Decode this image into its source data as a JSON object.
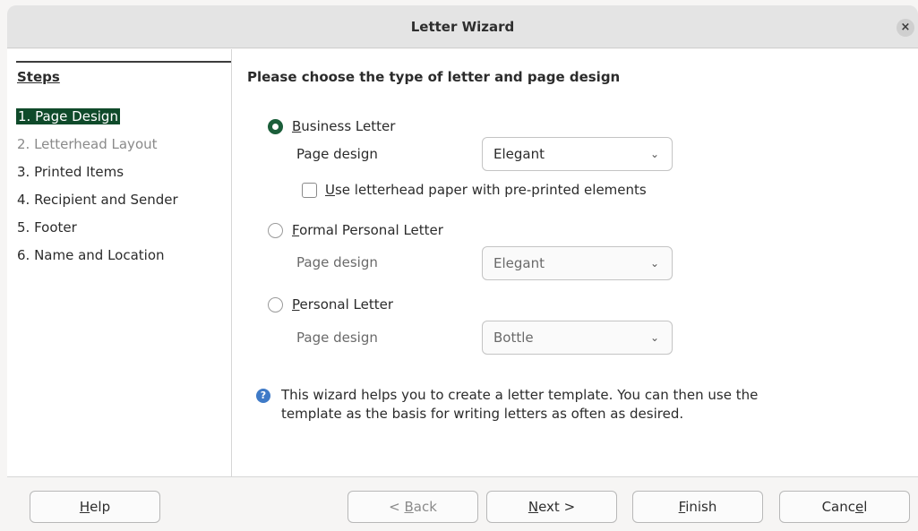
{
  "window": {
    "title": "Letter Wizard",
    "close_glyph": "×"
  },
  "sidebar": {
    "heading": "Steps",
    "steps": [
      {
        "label": "1. Page Design",
        "state": "active"
      },
      {
        "label": "2. Letterhead Layout",
        "state": "disabled"
      },
      {
        "label": "3. Printed Items",
        "state": "normal"
      },
      {
        "label": "4. Recipient and Sender",
        "state": "normal"
      },
      {
        "label": "5. Footer",
        "state": "normal"
      },
      {
        "label": "6. Name and Location",
        "state": "normal"
      }
    ]
  },
  "main": {
    "heading": "Please choose the type of letter and page design",
    "business": {
      "mnemonic": "B",
      "label_rest": "usiness Letter",
      "selected": true,
      "page_design_label": "Page design",
      "page_design_value": "Elegant",
      "letterhead_mnemonic": "U",
      "letterhead_rest": "se letterhead paper with pre-printed elements",
      "letterhead_checked": false
    },
    "formal": {
      "mnemonic": "F",
      "label_rest": "ormal Personal Letter",
      "selected": false,
      "page_design_label": "Page design",
      "page_design_value": "Elegant"
    },
    "personal": {
      "mnemonic": "P",
      "label_rest": "ersonal Letter",
      "selected": false,
      "page_design_label": "Page design",
      "page_design_value": "Bottle"
    },
    "info_icon": "?",
    "info_line1": "This wizard helps you to create a letter template. You can then use the",
    "info_line2": "template as the basis for writing letters as often as desired."
  },
  "buttons": {
    "help": {
      "mnemonic": "H",
      "rest": "elp"
    },
    "back": {
      "prefix": "< ",
      "mnemonic": "B",
      "rest": "ack"
    },
    "next": {
      "mnemonic": "N",
      "rest": "ext >"
    },
    "finish": {
      "mnemonic": "F",
      "rest": "inish"
    },
    "cancel": {
      "prefix": "Canc",
      "mnemonic": "e",
      "rest": "l"
    }
  },
  "icons": {
    "close": "close-icon",
    "chevron": "chevron-down-icon",
    "info": "info-icon"
  },
  "colors": {
    "accent": "#1b5e3a",
    "active_step_bg": "#0f4a2a",
    "info_icon": "#3f7ac7"
  }
}
